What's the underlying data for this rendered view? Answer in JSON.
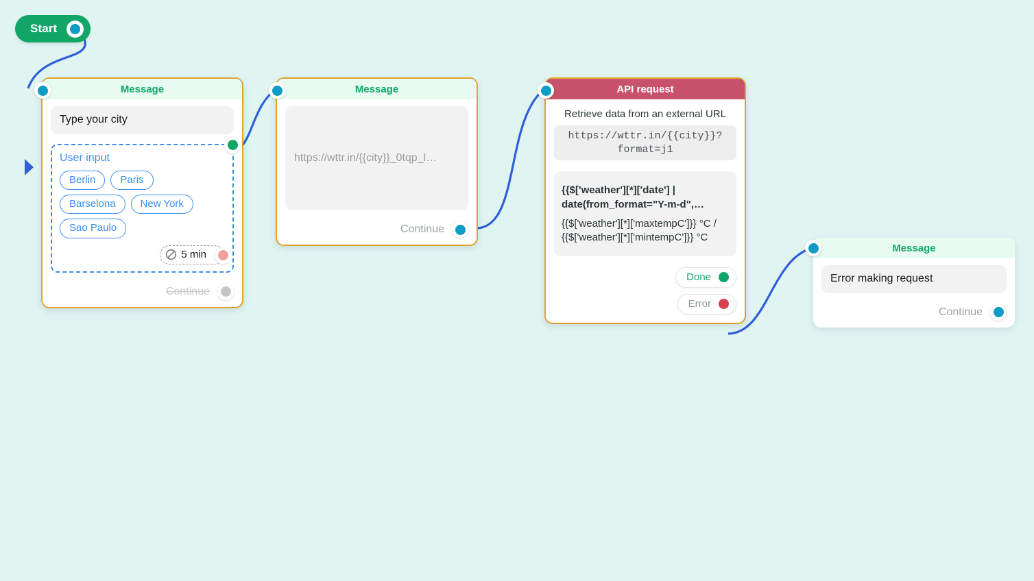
{
  "canvas": {
    "background": "#e0f4f2",
    "edge_color": "#2f5fd9",
    "node_border_color": "#e2a32b",
    "accent_teal": "#0d9cc4",
    "accent_green": "#11a668",
    "accent_red": "#c8516b",
    "accent_blue": "#3b8df0"
  },
  "start": {
    "label": "Start",
    "port_icon": "start-port-icon"
  },
  "nodes": [
    {
      "id": "message-city",
      "type": "Message",
      "header": "Message",
      "bubble_text": "Type your city",
      "user_input": {
        "title": "User input",
        "options": [
          "Berlin",
          "Paris",
          "Barselona",
          "New York",
          "Sao Paulo"
        ],
        "timeout": {
          "icon": "no-entry-icon",
          "label": "5 min"
        }
      },
      "footer": {
        "label": "Continue",
        "disabled": true
      }
    },
    {
      "id": "message-url",
      "type": "Message",
      "header": "Message",
      "bubble_placeholder": "https://wttr.in/{{city}}_0tqp_l…",
      "footer": {
        "label": "Continue",
        "disabled": false
      }
    },
    {
      "id": "api-request",
      "type": "API request",
      "header": "API request",
      "description": "Retrieve data from an external URL",
      "url": "https://wttr.in/{{city}}?format=j1",
      "mapping_strong": "{{$['weather'][*]['date'] | date(from_format=\"Y-m-d\",…",
      "mapping_plain": "{{$['weather'][*]['maxtempC']}} °C / {{$['weather'][*]['mintempC']}} °C",
      "outcomes": [
        {
          "label": "Done",
          "color": "#11a668"
        },
        {
          "label": "Error",
          "color": "#d8414f"
        }
      ]
    },
    {
      "id": "message-error",
      "type": "Message",
      "header": "Message",
      "bubble_text": "Error making request",
      "footer": {
        "label": "Continue",
        "disabled": false
      }
    }
  ]
}
